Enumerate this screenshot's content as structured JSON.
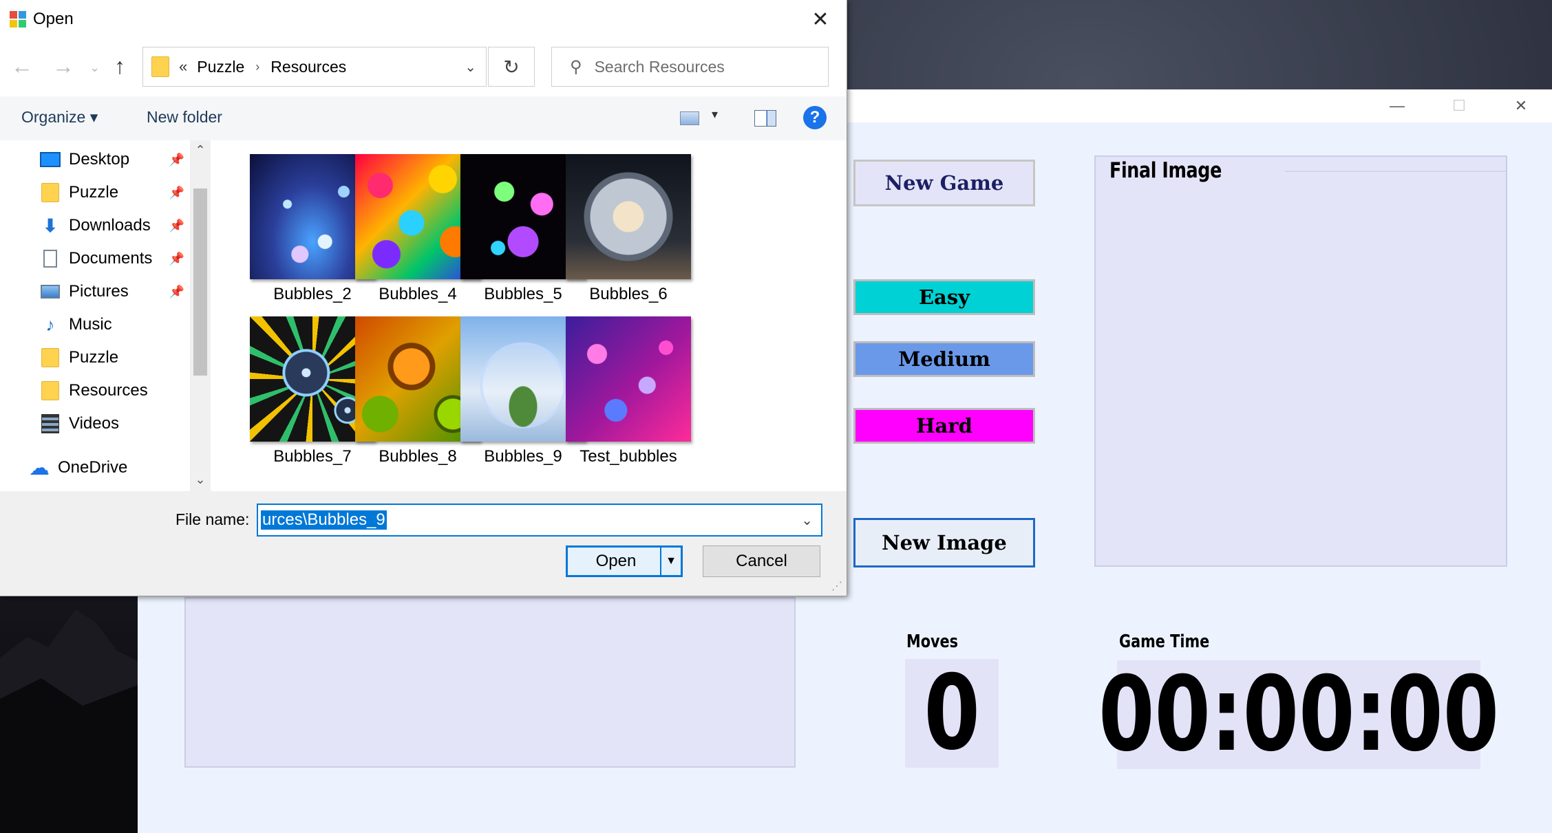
{
  "dialog": {
    "title": "Open",
    "close_icon": "close-icon",
    "breadcrumb": {
      "overflow": "«",
      "items": [
        "Puzzle",
        "Resources"
      ],
      "separator": "›"
    },
    "search_placeholder": "Search Resources",
    "toolbar": {
      "organize": "Organize ▾",
      "new_folder": "New folder",
      "help": "?"
    },
    "nav_items": [
      {
        "label": "Desktop",
        "icon": "desktop-icon",
        "pinned": true
      },
      {
        "label": "Puzzle",
        "icon": "folder-icon",
        "pinned": true
      },
      {
        "label": "Downloads",
        "icon": "downloads-icon",
        "pinned": true
      },
      {
        "label": "Documents",
        "icon": "documents-icon",
        "pinned": true
      },
      {
        "label": "Pictures",
        "icon": "pictures-icon",
        "pinned": true
      },
      {
        "label": "Music",
        "icon": "music-icon",
        "pinned": false
      },
      {
        "label": "Puzzle",
        "icon": "folder-icon",
        "pinned": false
      },
      {
        "label": "Resources",
        "icon": "folder-icon",
        "pinned": false
      },
      {
        "label": "Videos",
        "icon": "videos-icon",
        "pinned": false
      },
      {
        "label": "OneDrive",
        "icon": "onedrive-icon",
        "pinned": false
      }
    ],
    "files": [
      {
        "name": "Bubbles_2"
      },
      {
        "name": "Bubbles_4"
      },
      {
        "name": "Bubbles_5"
      },
      {
        "name": "Bubbles_6"
      },
      {
        "name": "Bubbles_7"
      },
      {
        "name": "Bubbles_8"
      },
      {
        "name": "Bubbles_9"
      },
      {
        "name": "Test_bubbles"
      }
    ],
    "file_name_label": "File name:",
    "file_name_value": "urces\\Bubbles_9",
    "open_button": "Open",
    "cancel_button": "Cancel"
  },
  "game": {
    "window_controls": {
      "minimize": "—",
      "maximize": "☐",
      "close": "✕"
    },
    "buttons": {
      "new_game": "New Game",
      "easy": "Easy",
      "medium": "Medium",
      "hard": "Hard",
      "new_image": "New Image"
    },
    "final_image_label": "Final Image",
    "moves_label": "Moves",
    "moves_value": "0",
    "game_time_label": "Game Time",
    "game_time_value": "00:00:00"
  },
  "colors": {
    "accent": "#0078d7",
    "easy": "#00d1d4",
    "medium": "#6a99ea",
    "hard": "#ff00ff",
    "game_background": "#edf3fe",
    "panel": "#e4e4f8"
  }
}
